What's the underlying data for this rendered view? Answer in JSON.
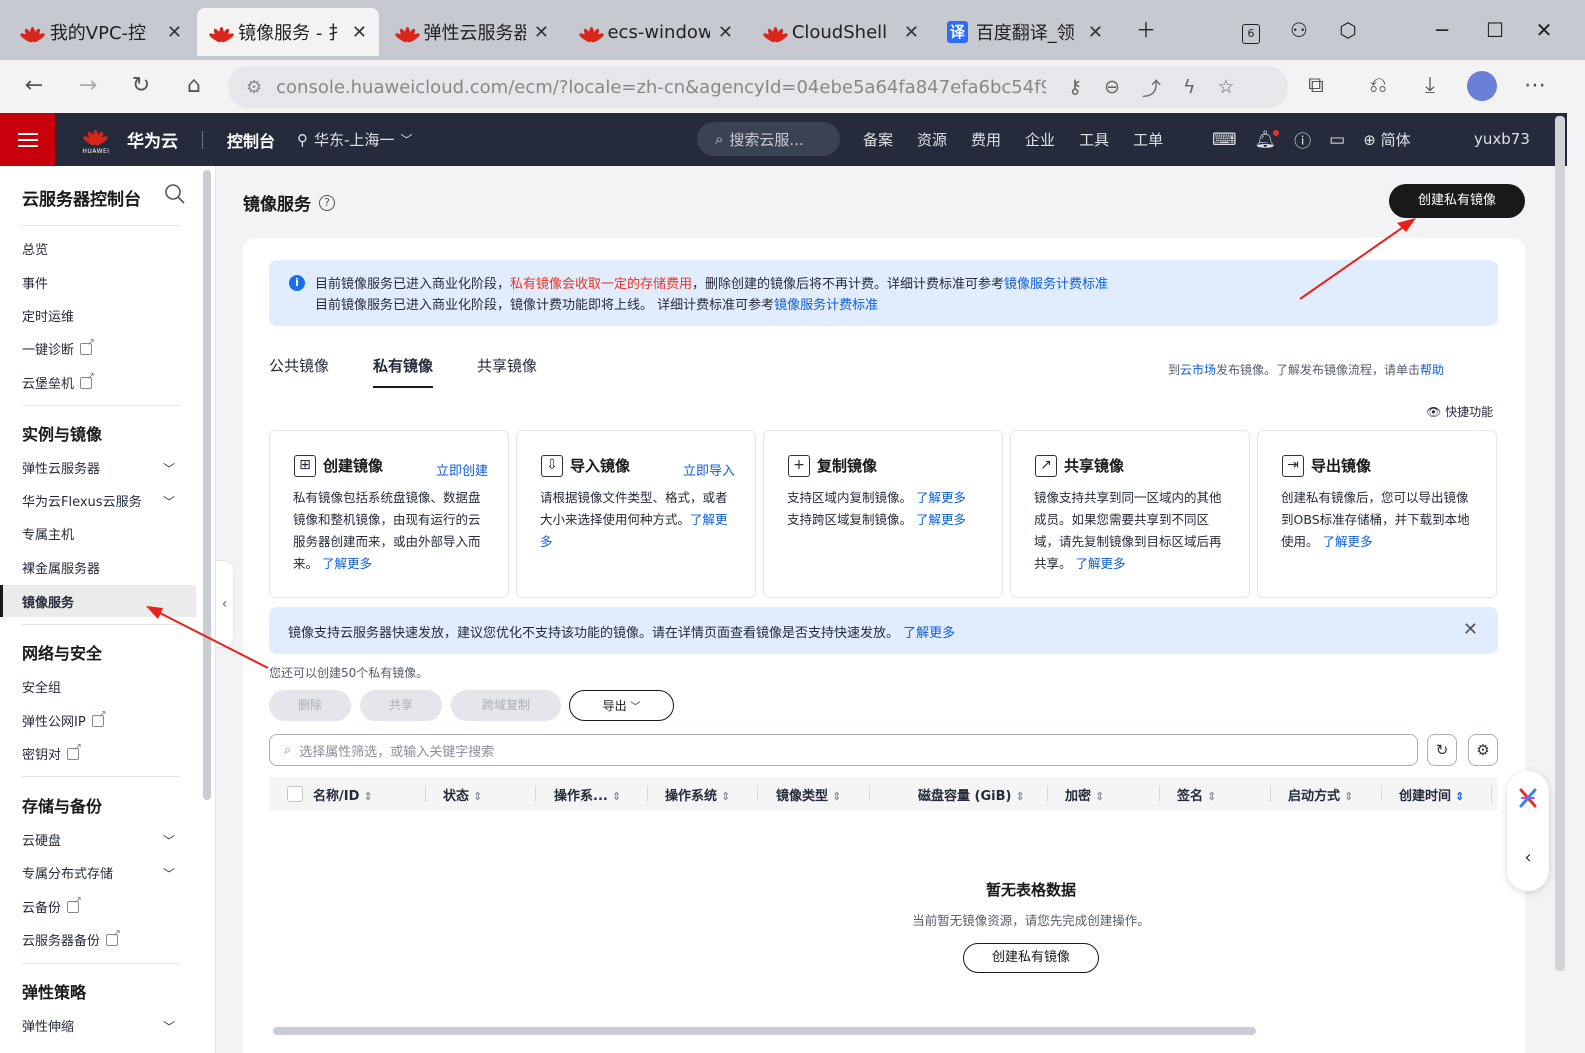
{
  "browser": {
    "tabs": [
      {
        "title": "我的VPC-控"
      },
      {
        "title": "镜像服务 - 扌"
      },
      {
        "title": "弹性云服务器"
      },
      {
        "title": "ecs-window"
      },
      {
        "title": "CloudShell"
      },
      {
        "title": "百度翻译_领"
      }
    ],
    "tab_count": "6",
    "url": "console.huaweicloud.com/ecm/?locale=zh-cn&agencyId=04ebe5a64fa847efa6bc54f91..."
  },
  "topnav": {
    "brand": "华为云",
    "logo_text": "HUAWEI",
    "console": "控制台",
    "region": "华东-上海一",
    "search_placeholder": "搜索云服...",
    "items": [
      "备案",
      "资源",
      "费用",
      "企业",
      "工具",
      "工单"
    ],
    "lang": "简体",
    "user": "yuxb73"
  },
  "sidebar": {
    "title": "云服务器控制台",
    "top_items": [
      "总览",
      "事件",
      "定时运维",
      "一键诊断",
      "云堡垒机"
    ],
    "groups": [
      {
        "title": "实例与镜像",
        "items": [
          "弹性云服务器",
          "华为云Flexus云服务",
          "专属主机",
          "裸金属服务器",
          "镜像服务"
        ]
      },
      {
        "title": "网络与安全",
        "items": [
          "安全组",
          "弹性公网IP",
          "密钥对"
        ]
      },
      {
        "title": "存储与备份",
        "items": [
          "云硬盘",
          "专属分布式存储",
          "云备份",
          "云服务器备份"
        ]
      },
      {
        "title": "弹性策略",
        "items": [
          "弹性伸缩"
        ]
      }
    ]
  },
  "main": {
    "title": "镜像服务",
    "create_button": "创建私有镜像",
    "notice": {
      "line1_a": "目前镜像服务已进入商业化阶段，",
      "line1_red": "私有镜像会收取一定的存储费用",
      "line1_b": "，删除创建的镜像后将不再计费。详细计费标准可参考",
      "line1_link": "镜像服务计费标准",
      "line2_a": "目前镜像服务已进入商业化阶段，镜像计费功能即将上线。 详细计费标准可参考",
      "line2_link": "镜像服务计费标准"
    },
    "tabs": [
      "公共镜像",
      "私有镜像",
      "共享镜像"
    ],
    "tabs_right_a": "到",
    "tabs_right_link1": "云市场",
    "tabs_right_b": "发布镜像。了解发布镜像流程，请单击",
    "tabs_right_link2": "帮助",
    "quick_label": "快捷功能",
    "features": [
      {
        "title": "创建镜像",
        "action": "立即创建",
        "desc": "私有镜像包括系统盘镜像、数据盘镜像和整机镜像，由现有运行的云服务器创建而来，或由外部导入而来。",
        "link": "了解更多"
      },
      {
        "title": "导入镜像",
        "action": "立即导入",
        "desc": "请根据镜像文件类型、格式，或者大小来选择使用何种方式。",
        "link": "了解更多"
      },
      {
        "title": "复制镜像",
        "action": "",
        "desc1": "支持区域内复制镜像。",
        "link1": "了解更多",
        "desc2": "支持跨区域复制镜像。",
        "link2": "了解更多"
      },
      {
        "title": "共享镜像",
        "action": "",
        "desc": "镜像支持共享到同一区域内的其他成员。如果您需要共享到不同区域，请先复制镜像到目标区域后再共享。",
        "link": "了解更多"
      },
      {
        "title": "导出镜像",
        "action": "",
        "desc": "创建私有镜像后，您可以导出镜像到OBS标准存储桶，并下载到本地使用。",
        "link": "了解更多"
      }
    ],
    "info2_text": "镜像支持云服务器快速发放，建议您优化不支持该功能的镜像。请在详情页面查看镜像是否支持快速发放。",
    "info2_link": "了解更多",
    "quota": "您还可以创建50个私有镜像。",
    "actions": {
      "delete": "删除",
      "share": "共享",
      "cross_copy": "跨域复制",
      "export": "导出"
    },
    "filter_placeholder": "选择属性筛选，或输入关键字搜索",
    "columns": [
      "名称/ID",
      "状态",
      "操作系...",
      "操作系统",
      "镜像类型",
      "磁盘容量 (GiB)",
      "加密",
      "签名",
      "启动方式",
      "创建时间"
    ],
    "empty_title": "暂无表格数据",
    "empty_desc": "当前暂无镜像资源，请您先完成创建操作。",
    "empty_button": "创建私有镜像"
  }
}
